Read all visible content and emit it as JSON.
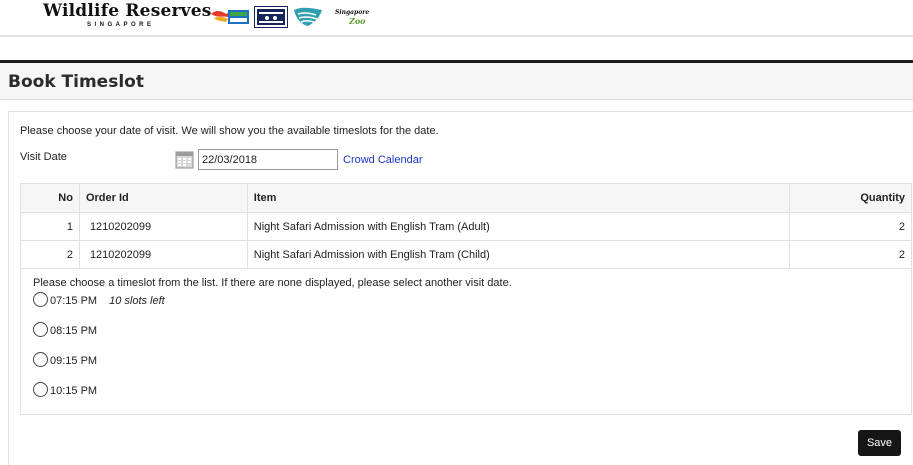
{
  "header": {
    "brand_name": "Wildlife Reserves",
    "brand_sub": "SINGAPORE",
    "partner_logos": [
      "jurong-bird-park-logo",
      "night-safari-logo",
      "river-safari-logo",
      "singapore-zoo-logo"
    ],
    "zoo_logo_text_top": "Singapore",
    "zoo_logo_text_bottom": "Zoo"
  },
  "page": {
    "title": "Book Timeslot"
  },
  "form": {
    "intro": "Please choose your date of visit. We will show you the available timeslots for the date.",
    "visit_date_label": "Visit Date",
    "visit_date_value": "22/03/2018",
    "crowd_calendar_link": "Crowd Calendar"
  },
  "orders": {
    "columns": [
      "No",
      "Order Id",
      "Item",
      "Quantity"
    ],
    "rows": [
      {
        "no": "1",
        "order_id": "1210202099",
        "item": "Night Safari Admission with English Tram (Adult)",
        "quantity": "2"
      },
      {
        "no": "2",
        "order_id": "1210202099",
        "item": "Night Safari Admission with English Tram (Child)",
        "quantity": "2"
      }
    ]
  },
  "timeslots": {
    "instruction": "Please choose a timeslot from the list. If there are none displayed, please select another visit date.",
    "slots": [
      {
        "time": "07:15 PM",
        "availability": "10 slots left"
      },
      {
        "time": "08:15 PM",
        "availability": ""
      },
      {
        "time": "09:15 PM",
        "availability": ""
      },
      {
        "time": "10:15 PM",
        "availability": ""
      }
    ]
  },
  "actions": {
    "save_label": "Save"
  },
  "colors": {
    "link": "#1a36c8",
    "button_bg": "#161616",
    "header_rule": "#1e1e1e"
  }
}
